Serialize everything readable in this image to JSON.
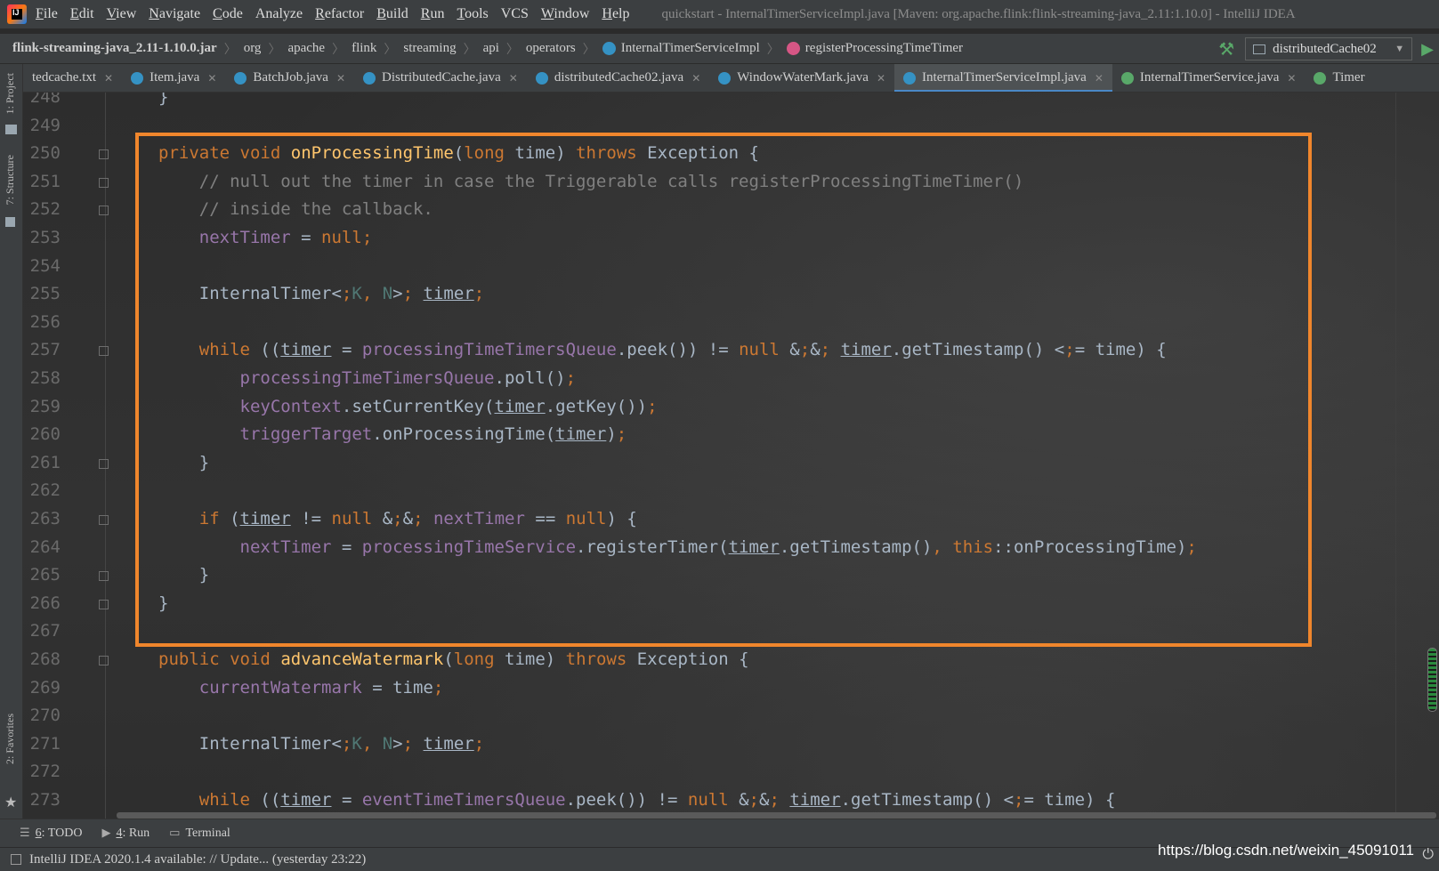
{
  "menubar": {
    "items": [
      {
        "label": "File",
        "mnemonic": "F",
        "rest": "ile"
      },
      {
        "label": "Edit",
        "mnemonic": "E",
        "rest": "dit"
      },
      {
        "label": "View",
        "mnemonic": "V",
        "rest": "iew"
      },
      {
        "label": "Navigate",
        "mnemonic": "N",
        "rest": "avigate"
      },
      {
        "label": "Code",
        "mnemonic": "C",
        "rest": "ode"
      },
      {
        "label": "Analyze",
        "mnemonic": "",
        "rest": "Analyze"
      },
      {
        "label": "Refactor",
        "mnemonic": "R",
        "rest": "efactor"
      },
      {
        "label": "Build",
        "mnemonic": "B",
        "rest": "uild"
      },
      {
        "label": "Run",
        "mnemonic": "R",
        "rest": "un"
      },
      {
        "label": "Tools",
        "mnemonic": "T",
        "rest": "ools"
      },
      {
        "label": "VCS",
        "mnemonic": "",
        "rest": "VCS"
      },
      {
        "label": "Window",
        "mnemonic": "W",
        "rest": "indow"
      },
      {
        "label": "Help",
        "mnemonic": "H",
        "rest": "elp"
      }
    ],
    "window_title": "quickstart - InternalTimerServiceImpl.java [Maven: org.apache.flink:flink-streaming-java_2.11:1.10.0] - IntelliJ IDEA"
  },
  "breadcrumb": {
    "items": [
      "flink-streaming-java_2.11-1.10.0.jar",
      "org",
      "apache",
      "flink",
      "streaming",
      "api",
      "operators",
      "InternalTimerServiceImpl",
      "registerProcessingTimeTimer"
    ],
    "run_config": "distributedCache02"
  },
  "tabs": [
    {
      "label": "tedcache.txt",
      "icon": "none"
    },
    {
      "label": "Item.java",
      "icon": "class-icon"
    },
    {
      "label": "BatchJob.java",
      "icon": "class-icon"
    },
    {
      "label": "DistributedCache.java",
      "icon": "class-icon"
    },
    {
      "label": "distributedCache02.java",
      "icon": "class-icon"
    },
    {
      "label": "WindowWaterMark.java",
      "icon": "class-icon"
    },
    {
      "label": "InternalTimerServiceImpl.java",
      "icon": "class-icon",
      "active": true
    },
    {
      "label": "InternalTimerService.java",
      "icon": "interface-icon"
    },
    {
      "label": "Timer",
      "icon": "interface-icon"
    }
  ],
  "left_tools": {
    "project": "1: Project",
    "structure": "7: Structure",
    "favorites": "2: Favorites"
  },
  "editor": {
    "lines": [
      {
        "n": "248",
        "text": "}"
      },
      {
        "n": "249",
        "text": ""
      },
      {
        "n": "250",
        "text": "private void onProcessingTime(long time) throws Exception {"
      },
      {
        "n": "251",
        "text": "    // null out the timer in case the Triggerable calls registerProcessingTimeTimer()"
      },
      {
        "n": "252",
        "text": "    // inside the callback."
      },
      {
        "n": "253",
        "text": "    nextTimer = null;"
      },
      {
        "n": "254",
        "text": ""
      },
      {
        "n": "255",
        "text": "    InternalTimer<K, N> timer;"
      },
      {
        "n": "256",
        "text": ""
      },
      {
        "n": "257",
        "text": "    while ((timer = processingTimeTimersQueue.peek()) != null && timer.getTimestamp() <= time) {"
      },
      {
        "n": "258",
        "text": "        processingTimeTimersQueue.poll();"
      },
      {
        "n": "259",
        "text": "        keyContext.setCurrentKey(timer.getKey());"
      },
      {
        "n": "260",
        "text": "        triggerTarget.onProcessingTime(timer);"
      },
      {
        "n": "261",
        "text": "    }"
      },
      {
        "n": "262",
        "text": ""
      },
      {
        "n": "263",
        "text": "    if (timer != null && nextTimer == null) {"
      },
      {
        "n": "264",
        "text": "        nextTimer = processingTimeService.registerTimer(timer.getTimestamp(), this::onProcessingTime);"
      },
      {
        "n": "265",
        "text": "    }"
      },
      {
        "n": "266",
        "text": "}"
      },
      {
        "n": "267",
        "text": ""
      },
      {
        "n": "268",
        "text": "public void advanceWatermark(long time) throws Exception {"
      },
      {
        "n": "269",
        "text": "    currentWatermark = time;"
      },
      {
        "n": "270",
        "text": ""
      },
      {
        "n": "271",
        "text": "    InternalTimer<K, N> timer;"
      },
      {
        "n": "272",
        "text": ""
      },
      {
        "n": "273",
        "text": "    while ((timer = eventTimeTimersQueue.peek()) != null && timer.getTimestamp() <= time) {"
      }
    ],
    "highlight_color": "#f0862c"
  },
  "bottom_tools": [
    {
      "num": "6",
      "label": ": TODO"
    },
    {
      "num": "4",
      "label": ": Run"
    },
    {
      "num": "",
      "label": "Terminal"
    }
  ],
  "status": {
    "text": "IntelliJ IDEA 2020.1.4 available: // Update... (yesterday 23:22)",
    "watermark": "https://blog.csdn.net/weixin_45091011"
  },
  "colors": {
    "keyword": "#cc7832",
    "function": "#ffc66d",
    "field": "#9876aa",
    "comment": "#808080",
    "type_param": "#507874",
    "text": "#a9b7c6"
  }
}
